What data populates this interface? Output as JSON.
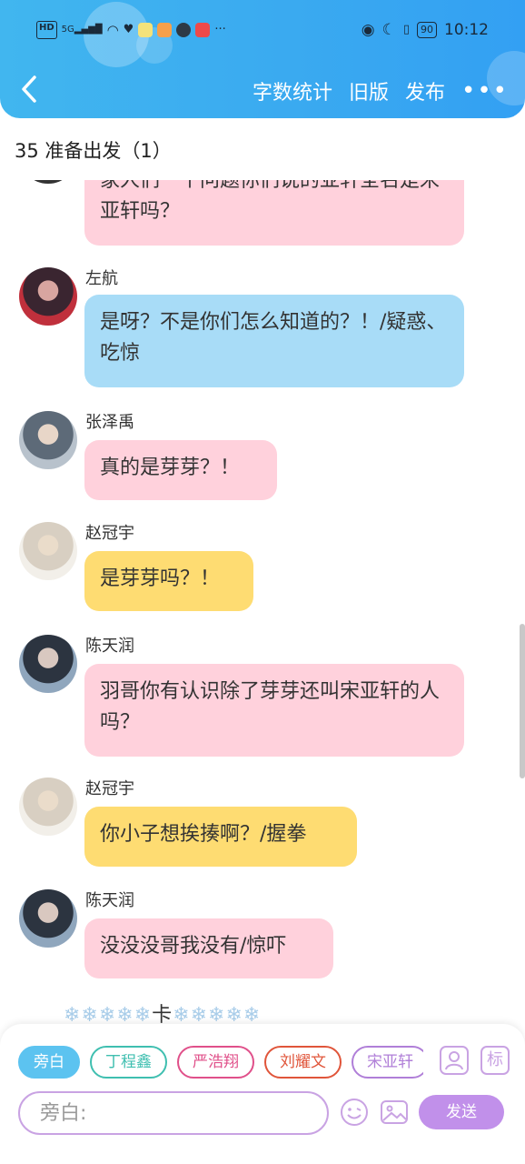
{
  "status_bar": {
    "hd": "HD",
    "network": "5G",
    "battery": "90",
    "time": "10:12",
    "more": "···"
  },
  "header": {
    "back_icon": "chevron-left-icon",
    "word_count": "字数统计",
    "old_version": "旧版",
    "publish": "发布",
    "more": "•••"
  },
  "chat": {
    "title": "35 准备出发（1）"
  },
  "messages": [
    {
      "sender": "",
      "text": "家人们一个问题你们说的亚轩全名是宋亚轩吗？",
      "color": "#ffd1dc"
    },
    {
      "sender": "左航",
      "text": "是呀？不是你们怎么知道的？！/疑惑、吃惊",
      "color": "#a8dcf7"
    },
    {
      "sender": "张泽禹",
      "text": "真的是芽芽？！",
      "color": "#ffd1dc"
    },
    {
      "sender": "赵冠宇",
      "text": "是芽芽吗？！",
      "color": "#fedc72"
    },
    {
      "sender": "陈天润",
      "text": "羽哥你有认识除了芽芽还叫宋亚轩的人吗？",
      "color": "#ffd1dc"
    },
    {
      "sender": "赵冠宇",
      "text": "你小子想挨揍啊？/握拳",
      "color": "#fedc72"
    },
    {
      "sender": "陈天润",
      "text": "没没没哥我没有/惊吓",
      "color": "#ffd1dc"
    }
  ],
  "divider": {
    "left": "❄❄❄❄❄",
    "center": "卡",
    "right": "❄❄❄❄❄"
  },
  "bottom": {
    "chips": [
      {
        "label": "旁白",
        "color": "#5cc3f0"
      },
      {
        "label": "丁程鑫",
        "color": "#3fbfb0"
      },
      {
        "label": "严浩翔",
        "color": "#e0508a"
      },
      {
        "label": "刘耀文",
        "color": "#e0553a"
      },
      {
        "label": "宋亚轩",
        "color": "#b07fd8"
      }
    ],
    "profile_icon": "user-card-icon",
    "tag_label": "标",
    "input_placeholder": "旁白:",
    "emoji_icon": "smile-icon",
    "image_icon": "image-icon",
    "send": "发送"
  },
  "colors": {
    "header_gradient_start": "#41b6ef",
    "header_gradient_end": "#33a0f3",
    "accent_purple": "#c190ea",
    "bubble_pink": "#ffd1dc",
    "bubble_blue": "#a8dcf7",
    "bubble_yellow": "#fedc72"
  }
}
